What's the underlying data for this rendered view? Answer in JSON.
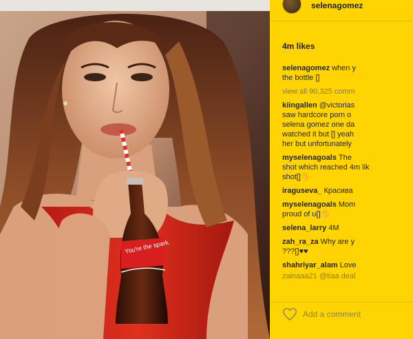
{
  "post": {
    "username": "selenagomez",
    "likes": "4m likes",
    "caption_user": "selenagomez",
    "caption_text": "when y",
    "caption_line2": "the bottle []",
    "view_all": "view all 90,325 comm",
    "comments": [
      {
        "user": "kiingallen",
        "lines": [
          "@victorias",
          "saw hardcore porn o",
          "selena gomez one da",
          "watched it but [] yeah",
          "her but unfortunately"
        ]
      },
      {
        "user": "myselenagoals",
        "lines": [
          "The",
          "shot which reached 4m lik",
          "shot[]🖐"
        ]
      },
      {
        "user": "iraguseva_",
        "lines": [
          "Красива"
        ]
      },
      {
        "user": "myselenagoals",
        "lines": [
          "Mom",
          "proud of u[]🖐"
        ]
      },
      {
        "user": "selena_larry",
        "lines": [
          "4M"
        ]
      },
      {
        "user": "zah_ra_za",
        "lines": [
          "Why are y",
          "???[]♥♥"
        ]
      },
      {
        "user": "shahriyar_alam",
        "lines": [
          "Love"
        ]
      }
    ],
    "cut_comment": "zainaaa21 @tiaa deal",
    "add_comment": "Add a comment"
  },
  "photo": {
    "bottle_label": "You're the spark."
  },
  "colors": {
    "panel": "#ffd400",
    "dress": "#d8281e",
    "hair": "#6a3420"
  },
  "icons": [
    "heart-icon",
    "avatar"
  ]
}
